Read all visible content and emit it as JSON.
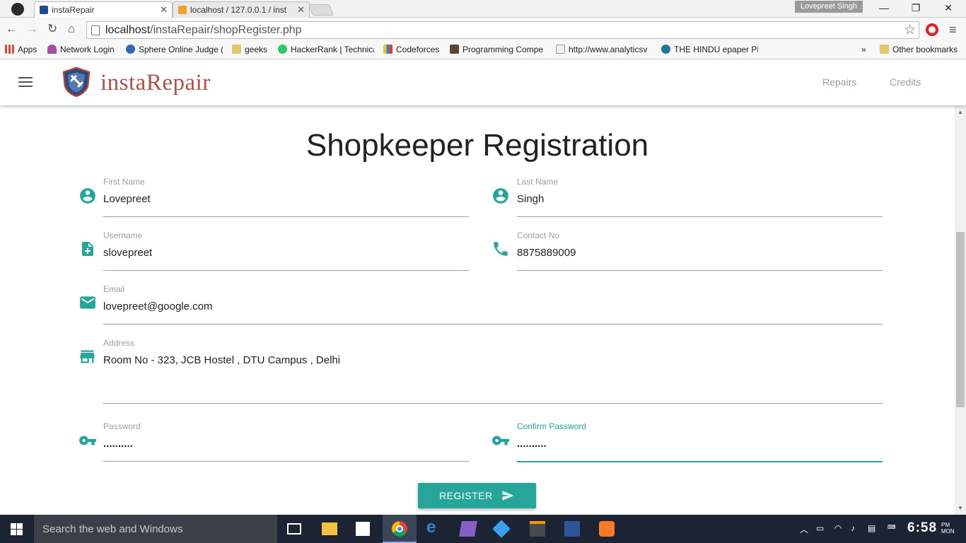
{
  "browser": {
    "tabs": [
      {
        "title": "instaRepair"
      },
      {
        "title": "localhost / 127.0.0.1 / inst"
      }
    ],
    "profile_name": "Lovepreet Singh",
    "url_host": "localhost",
    "url_path": "/instaRepair/shopRegister.php",
    "bookmarks": [
      "Apps",
      "Network Login",
      "Sphere Online Judge (",
      "geeks",
      "HackerRank | Technica",
      "Codeforces",
      "Programming Compe",
      "http://www.analyticsv",
      "THE HINDU epaper PD",
      "Other bookmarks"
    ],
    "overflow_label": "»"
  },
  "app": {
    "brand": "instaRepair",
    "nav": [
      "Repairs",
      "Credits"
    ]
  },
  "form": {
    "title": "Shopkeeper Registration",
    "first_name": {
      "label": "First Name",
      "value": "Lovepreet"
    },
    "last_name": {
      "label": "Last Name",
      "value": "Singh"
    },
    "username": {
      "label": "Username",
      "value": "slovepreet"
    },
    "contact": {
      "label": "Contact No",
      "value": "8875889009"
    },
    "email": {
      "label": "Email",
      "value": "lovepreet@google.com"
    },
    "address": {
      "label": "Address",
      "value": "Room No - 323, JCB Hostel , DTU Campus , Delhi"
    },
    "password": {
      "label": "Password",
      "value": ".........."
    },
    "confirm_password": {
      "label": "Confirm Password",
      "value": ".........."
    },
    "register_label": "REGISTER"
  },
  "colors": {
    "accent": "#26a69a",
    "brand": "#b0504a"
  },
  "taskbar": {
    "search_placeholder": "Search the web and Windows",
    "time": "6:58",
    "ampm": "PM",
    "day": "MON"
  }
}
